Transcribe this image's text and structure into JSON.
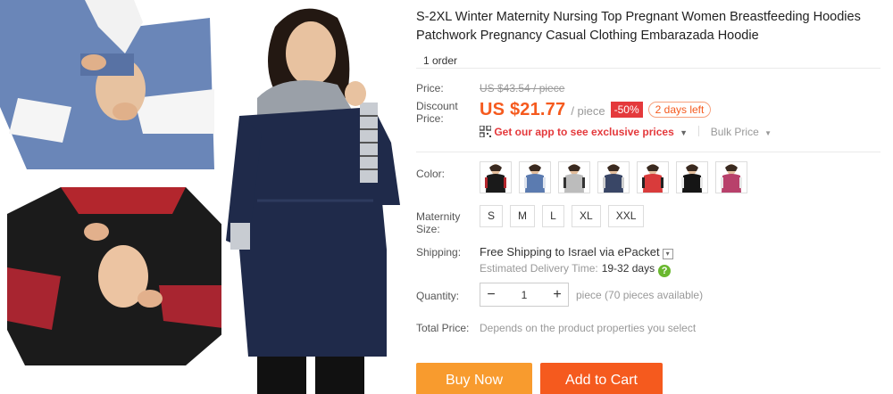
{
  "product": {
    "title": "S-2XL Winter Maternity Nursing Top Pregnant Women Breastfeeding Hoodies Patchwork Pregnancy Casual Clothing Embarazada Hoodie",
    "orders": "1 order"
  },
  "price": {
    "label": "Price:",
    "original": "US $43.54 / piece",
    "discount_label": "Discount Price:",
    "current": "US $21.77",
    "unit": "/ piece",
    "discount_badge": "-50%",
    "days_left": "2 days left",
    "app_promo": "Get our app to see exclusive prices",
    "bulk_price": "Bulk Price"
  },
  "color": {
    "label": "Color:",
    "swatches": [
      {
        "name": "black-red",
        "body": "#1a1a1a",
        "accent": "#b3262d"
      },
      {
        "name": "blue",
        "body": "#5b7bb0",
        "accent": "#dfe4ee"
      },
      {
        "name": "light-gray",
        "body": "#bcbcbc",
        "accent": "#333333"
      },
      {
        "name": "dark-blue-stripe",
        "body": "#394666",
        "accent": "#cfcfcf"
      },
      {
        "name": "red",
        "body": "#d93b3b",
        "accent": "#222222"
      },
      {
        "name": "black-white",
        "body": "#151515",
        "accent": "#e9e9e9"
      },
      {
        "name": "rose",
        "body": "#b8416b",
        "accent": "#e8e8e8"
      }
    ]
  },
  "size": {
    "label": "Maternity Size:",
    "options": [
      "S",
      "M",
      "L",
      "XL",
      "XXL"
    ]
  },
  "shipping": {
    "label": "Shipping:",
    "text": "Free Shipping to Israel via ePacket",
    "estimate_label": "Estimated Delivery Time:",
    "estimate_days": "19-32 days"
  },
  "quantity": {
    "label": "Quantity:",
    "value": "1",
    "available": "piece (70 pieces available)"
  },
  "total": {
    "label": "Total Price:",
    "value": "Depends on the product properties you select"
  },
  "actions": {
    "buy_now": "Buy Now",
    "add_to_cart": "Add to Cart"
  },
  "colors": {
    "accent": "#f55a1e",
    "buy": "#f89b2e",
    "badge": "#e4393c"
  }
}
